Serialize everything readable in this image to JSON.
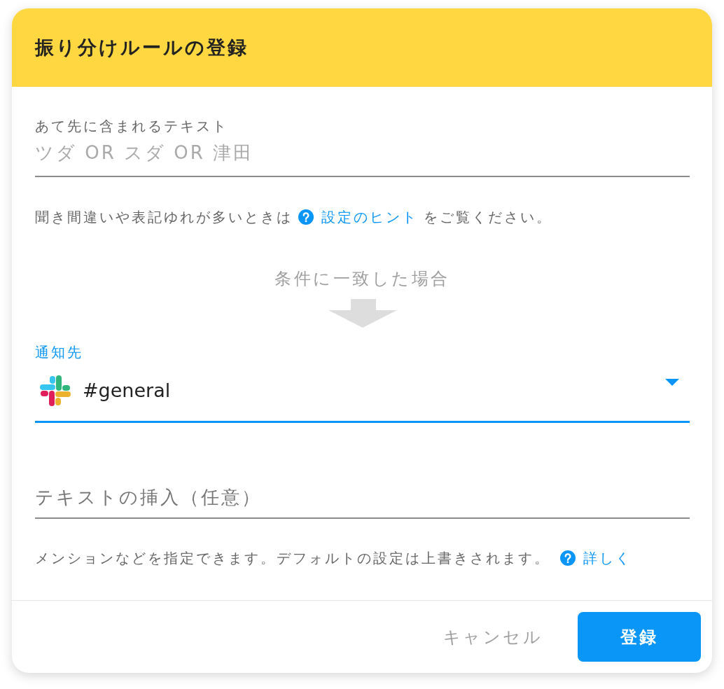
{
  "dialog": {
    "title": "振り分けルールの登録"
  },
  "recipient_field": {
    "label": "あて先に含まれるテキスト",
    "placeholder": "ツダ OR スダ OR 津田"
  },
  "recipient_hint": {
    "text": "聞き間違いや表記ゆれが多いときは",
    "link": "設定のヒント",
    "text_after": "をご覧ください。"
  },
  "condition": {
    "caption": "条件に一致した場合"
  },
  "notify_field": {
    "label": "通知先",
    "value": "#general",
    "focused": true
  },
  "insert_field": {
    "placeholder": "テキストの挿入（任意）"
  },
  "insert_hint": {
    "text": "メンションなどを指定できます。デフォルトの設定は上書きされます。",
    "link": "詳しく"
  },
  "buttons": [
    {
      "label": "キャンセル",
      "kind": "text"
    },
    {
      "label": "登録",
      "kind": "primary"
    }
  ]
}
